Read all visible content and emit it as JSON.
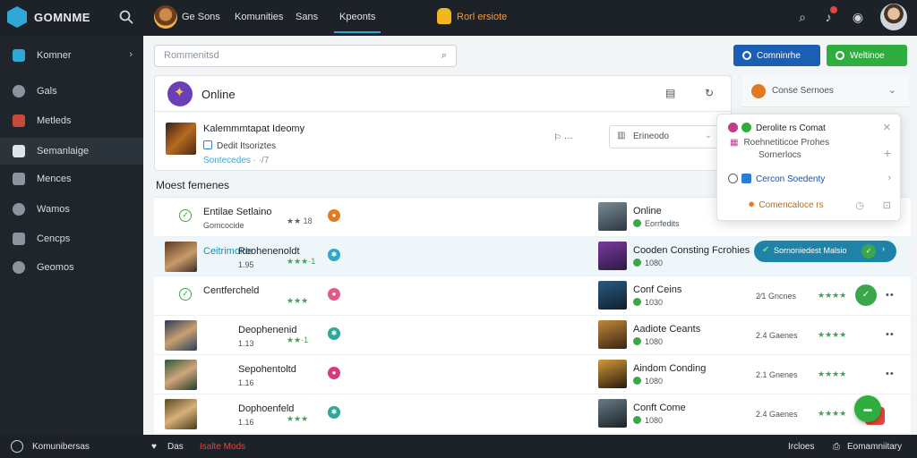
{
  "topbar": {
    "logo_text": "GOMNME",
    "nav": [
      "Ge Sons",
      "Komunities",
      "Sans",
      "Kpeonts"
    ],
    "notice": "Rorl ersiote"
  },
  "sidebar": {
    "items": [
      {
        "label": "Komner",
        "icon": "home-icon"
      },
      {
        "label": "Gals",
        "icon": "goal-icon"
      },
      {
        "label": "Metleds",
        "icon": "chat-icon"
      },
      {
        "label": "Semanlaige",
        "icon": "home-icon"
      },
      {
        "label": "Mences",
        "icon": "grid-icon"
      },
      {
        "label": "Wamos",
        "icon": "heart-icon"
      },
      {
        "label": "Cencps",
        "icon": "image-icon"
      },
      {
        "label": "Geomos",
        "icon": "cloud-icon"
      }
    ]
  },
  "search": {
    "placeholder": "Rommenitsd"
  },
  "buttons": {
    "primary": "Comninrhe",
    "secondary": "Weltinoe"
  },
  "panel": {
    "title": "Online",
    "playlist": {
      "title": "Kalemmmtapat Ideomy",
      "subtitle": "Dedit Itsoriztes",
      "link": "Sontecedes",
      "link_count": "· ·/7",
      "count": "⚐ ···",
      "filter": "Erineodo"
    }
  },
  "side_right": {
    "text": "Conse Sernoes"
  },
  "section_heading": "Moest femenes",
  "rows": [
    {
      "name": "Entilae Setlaino",
      "meta": "Gomcocide",
      "stars": "★★",
      "count": "18",
      "status_color": "#e07b22",
      "right_name": "Online",
      "right_meta": "Eorrfedits",
      "right_count": "",
      "right_stars": "",
      "checked": true
    },
    {
      "name": "Ceitrimoide",
      "meta": "Reohenenoldt",
      "sub": "1.95",
      "stars": "★★★·1",
      "status_color": "#2ea8c9",
      "right_name": "Cooden Consting Fcrohies",
      "right_meta": "1080",
      "highlight": true,
      "pill": "Sornoniedest Malsio"
    },
    {
      "name": "Centfercheld",
      "meta": "",
      "stars": "★★★",
      "status_color": "#e05a8a",
      "right_name": "Conf Ceins",
      "right_meta": "1030",
      "right_count": "2⁄1 Gncnes",
      "right_stars": "★★★★",
      "checked": true
    },
    {
      "name": "Deophenenid",
      "meta": "1.13",
      "stars": "★★·1",
      "status_color": "#2ea89a",
      "right_name": "Aadiote Ceants",
      "right_meta": "1080",
      "right_count": "2.4 Gaenes",
      "right_stars": "★★★★"
    },
    {
      "name": "Sepohentoltd",
      "meta": "1.16",
      "stars": "",
      "status_color": "#d43c80",
      "right_name": "Aindom Conding",
      "right_meta": "1080",
      "right_count": "2.1 Gnenes",
      "right_stars": "★★★★"
    },
    {
      "name": "Dophoenfeld",
      "meta": "1.16",
      "stars": "★★★",
      "status_color": "#2ea89a",
      "right_name": "Conft Come",
      "right_meta": "1080",
      "right_count": "2.4 Gaenes",
      "right_stars": "★★★★"
    }
  ],
  "popup": {
    "row1": "Derolite rs Comat",
    "row2": "Roehnetiticoe Prohes",
    "row2b": "Sornerlocs",
    "row3": "Cercon Soedenty",
    "row4": "Comencaloce rs"
  },
  "bottombar": {
    "left": "Komunibersas",
    "mid": "Das",
    "mid2": "Isalte Mods",
    "right1": "Ircloes",
    "right2": "Eomamniitary"
  }
}
